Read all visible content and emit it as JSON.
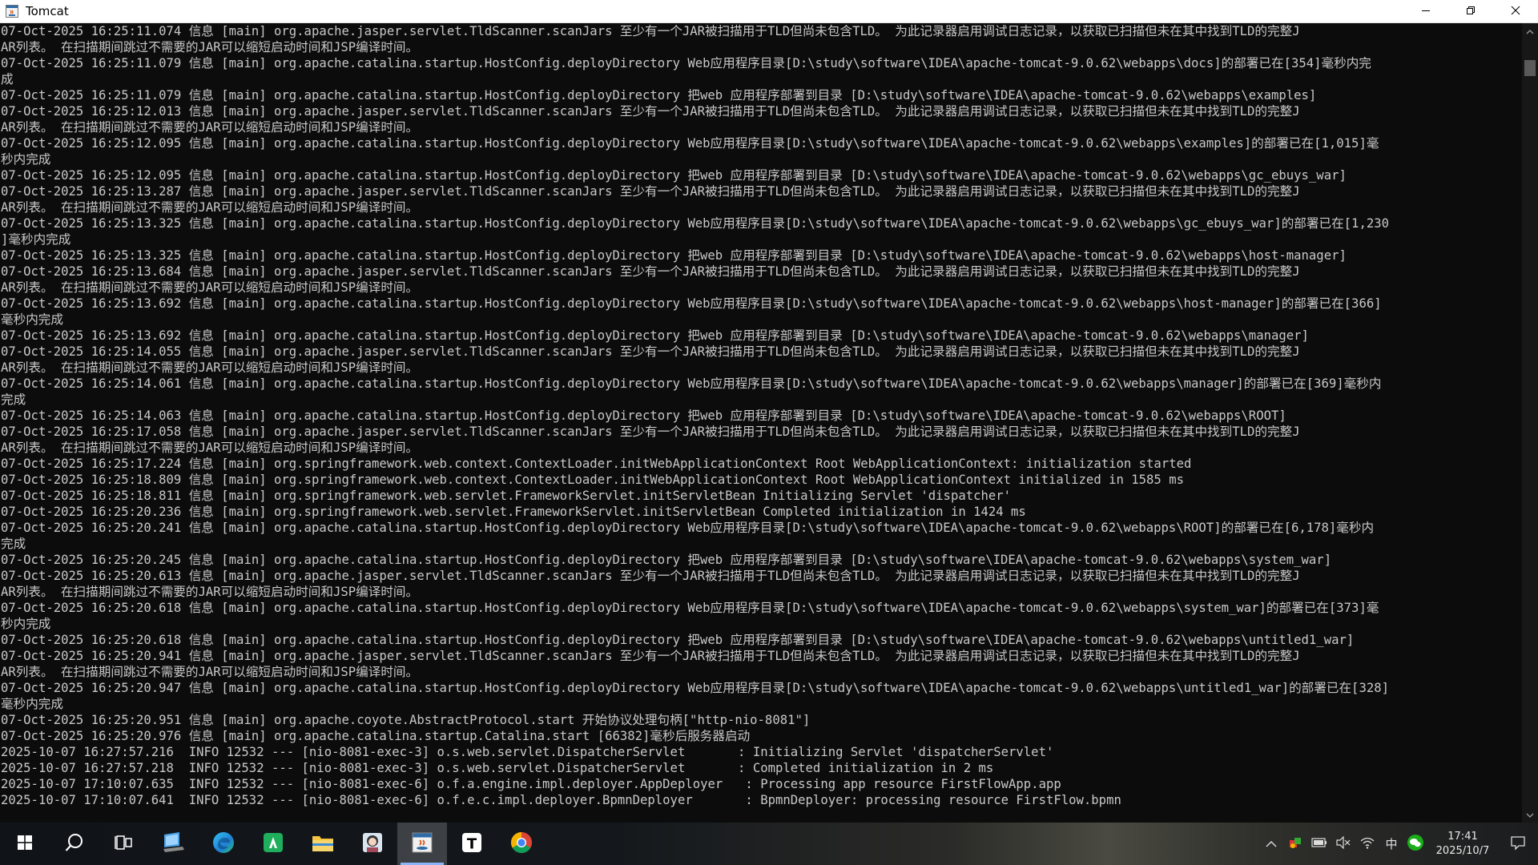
{
  "window": {
    "title": "Tomcat",
    "icon": "java-console-icon",
    "controls": [
      "minimize-icon",
      "restore-icon",
      "close-icon"
    ]
  },
  "console": {
    "lines": [
      "07-Oct-2025 16:25:11.074 信息 [main] org.apache.jasper.servlet.TldScanner.scanJars 至少有一个JAR被扫描用于TLD但尚未包含TLD。 为此记录器启用调试日志记录，以获取已扫描但未在其中找到TLD的完整J",
      "AR列表。 在扫描期间跳过不需要的JAR可以缩短启动时间和JSP编译时间。",
      "07-Oct-2025 16:25:11.079 信息 [main] org.apache.catalina.startup.HostConfig.deployDirectory Web应用程序目录[D:\\study\\software\\IDEA\\apache-tomcat-9.0.62\\webapps\\docs]的部署已在[354]毫秒内完",
      "成",
      "07-Oct-2025 16:25:11.079 信息 [main] org.apache.catalina.startup.HostConfig.deployDirectory 把web 应用程序部署到目录 [D:\\study\\software\\IDEA\\apache-tomcat-9.0.62\\webapps\\examples]",
      "07-Oct-2025 16:25:12.013 信息 [main] org.apache.jasper.servlet.TldScanner.scanJars 至少有一个JAR被扫描用于TLD但尚未包含TLD。 为此记录器启用调试日志记录，以获取已扫描但未在其中找到TLD的完整J",
      "AR列表。 在扫描期间跳过不需要的JAR可以缩短启动时间和JSP编译时间。",
      "07-Oct-2025 16:25:12.095 信息 [main] org.apache.catalina.startup.HostConfig.deployDirectory Web应用程序目录[D:\\study\\software\\IDEA\\apache-tomcat-9.0.62\\webapps\\examples]的部署已在[1,015]毫",
      "秒内完成",
      "07-Oct-2025 16:25:12.095 信息 [main] org.apache.catalina.startup.HostConfig.deployDirectory 把web 应用程序部署到目录 [D:\\study\\software\\IDEA\\apache-tomcat-9.0.62\\webapps\\gc_ebuys_war]",
      "07-Oct-2025 16:25:13.287 信息 [main] org.apache.jasper.servlet.TldScanner.scanJars 至少有一个JAR被扫描用于TLD但尚未包含TLD。 为此记录器启用调试日志记录，以获取已扫描但未在其中找到TLD的完整J",
      "AR列表。 在扫描期间跳过不需要的JAR可以缩短启动时间和JSP编译时间。",
      "07-Oct-2025 16:25:13.325 信息 [main] org.apache.catalina.startup.HostConfig.deployDirectory Web应用程序目录[D:\\study\\software\\IDEA\\apache-tomcat-9.0.62\\webapps\\gc_ebuys_war]的部署已在[1,230",
      "]毫秒内完成",
      "07-Oct-2025 16:25:13.325 信息 [main] org.apache.catalina.startup.HostConfig.deployDirectory 把web 应用程序部署到目录 [D:\\study\\software\\IDEA\\apache-tomcat-9.0.62\\webapps\\host-manager]",
      "07-Oct-2025 16:25:13.684 信息 [main] org.apache.jasper.servlet.TldScanner.scanJars 至少有一个JAR被扫描用于TLD但尚未包含TLD。 为此记录器启用调试日志记录，以获取已扫描但未在其中找到TLD的完整J",
      "AR列表。 在扫描期间跳过不需要的JAR可以缩短启动时间和JSP编译时间。",
      "07-Oct-2025 16:25:13.692 信息 [main] org.apache.catalina.startup.HostConfig.deployDirectory Web应用程序目录[D:\\study\\software\\IDEA\\apache-tomcat-9.0.62\\webapps\\host-manager]的部署已在[366]",
      "毫秒内完成",
      "07-Oct-2025 16:25:13.692 信息 [main] org.apache.catalina.startup.HostConfig.deployDirectory 把web 应用程序部署到目录 [D:\\study\\software\\IDEA\\apache-tomcat-9.0.62\\webapps\\manager]",
      "07-Oct-2025 16:25:14.055 信息 [main] org.apache.jasper.servlet.TldScanner.scanJars 至少有一个JAR被扫描用于TLD但尚未包含TLD。 为此记录器启用调试日志记录，以获取已扫描但未在其中找到TLD的完整J",
      "AR列表。 在扫描期间跳过不需要的JAR可以缩短启动时间和JSP编译时间。",
      "07-Oct-2025 16:25:14.061 信息 [main] org.apache.catalina.startup.HostConfig.deployDirectory Web应用程序目录[D:\\study\\software\\IDEA\\apache-tomcat-9.0.62\\webapps\\manager]的部署已在[369]毫秒内",
      "完成",
      "07-Oct-2025 16:25:14.063 信息 [main] org.apache.catalina.startup.HostConfig.deployDirectory 把web 应用程序部署到目录 [D:\\study\\software\\IDEA\\apache-tomcat-9.0.62\\webapps\\ROOT]",
      "07-Oct-2025 16:25:17.058 信息 [main] org.apache.jasper.servlet.TldScanner.scanJars 至少有一个JAR被扫描用于TLD但尚未包含TLD。 为此记录器启用调试日志记录，以获取已扫描但未在其中找到TLD的完整J",
      "AR列表。 在扫描期间跳过不需要的JAR可以缩短启动时间和JSP编译时间。",
      "07-Oct-2025 16:25:17.224 信息 [main] org.springframework.web.context.ContextLoader.initWebApplicationContext Root WebApplicationContext: initialization started",
      "07-Oct-2025 16:25:18.809 信息 [main] org.springframework.web.context.ContextLoader.initWebApplicationContext Root WebApplicationContext initialized in 1585 ms",
      "07-Oct-2025 16:25:18.811 信息 [main] org.springframework.web.servlet.FrameworkServlet.initServletBean Initializing Servlet 'dispatcher'",
      "07-Oct-2025 16:25:20.236 信息 [main] org.springframework.web.servlet.FrameworkServlet.initServletBean Completed initialization in 1424 ms",
      "07-Oct-2025 16:25:20.241 信息 [main] org.apache.catalina.startup.HostConfig.deployDirectory Web应用程序目录[D:\\study\\software\\IDEA\\apache-tomcat-9.0.62\\webapps\\ROOT]的部署已在[6,178]毫秒内",
      "完成",
      "07-Oct-2025 16:25:20.245 信息 [main] org.apache.catalina.startup.HostConfig.deployDirectory 把web 应用程序部署到目录 [D:\\study\\software\\IDEA\\apache-tomcat-9.0.62\\webapps\\system_war]",
      "07-Oct-2025 16:25:20.613 信息 [main] org.apache.jasper.servlet.TldScanner.scanJars 至少有一个JAR被扫描用于TLD但尚未包含TLD。 为此记录器启用调试日志记录，以获取已扫描但未在其中找到TLD的完整J",
      "AR列表。 在扫描期间跳过不需要的JAR可以缩短启动时间和JSP编译时间。",
      "07-Oct-2025 16:25:20.618 信息 [main] org.apache.catalina.startup.HostConfig.deployDirectory Web应用程序目录[D:\\study\\software\\IDEA\\apache-tomcat-9.0.62\\webapps\\system_war]的部署已在[373]毫",
      "秒内完成",
      "07-Oct-2025 16:25:20.618 信息 [main] org.apache.catalina.startup.HostConfig.deployDirectory 把web 应用程序部署到目录 [D:\\study\\software\\IDEA\\apache-tomcat-9.0.62\\webapps\\untitled1_war]",
      "07-Oct-2025 16:25:20.941 信息 [main] org.apache.jasper.servlet.TldScanner.scanJars 至少有一个JAR被扫描用于TLD但尚未包含TLD。 为此记录器启用调试日志记录，以获取已扫描但未在其中找到TLD的完整J",
      "AR列表。 在扫描期间跳过不需要的JAR可以缩短启动时间和JSP编译时间。",
      "07-Oct-2025 16:25:20.947 信息 [main] org.apache.catalina.startup.HostConfig.deployDirectory Web应用程序目录[D:\\study\\software\\IDEA\\apache-tomcat-9.0.62\\webapps\\untitled1_war]的部署已在[328]",
      "毫秒内完成",
      "07-Oct-2025 16:25:20.951 信息 [main] org.apache.coyote.AbstractProtocol.start 开始协议处理句柄[\"http-nio-8081\"]",
      "07-Oct-2025 16:25:20.976 信息 [main] org.apache.catalina.startup.Catalina.start [66382]毫秒后服务器启动",
      "2025-10-07 16:27:57.216  INFO 12532 --- [nio-8081-exec-3] o.s.web.servlet.DispatcherServlet       : Initializing Servlet 'dispatcherServlet'",
      "2025-10-07 16:27:57.218  INFO 12532 --- [nio-8081-exec-3] o.s.web.servlet.DispatcherServlet       : Completed initialization in 2 ms",
      "2025-10-07 17:10:07.635  INFO 12532 --- [nio-8081-exec-6] o.f.a.engine.impl.deployer.AppDeployer   : Processing app resource FirstFlowApp.app",
      "2025-10-07 17:10:07.641  INFO 12532 --- [nio-8081-exec-6] o.f.e.c.impl.deployer.BpmnDeployer       : BpmnDeployer: processing resource FirstFlow.bpmn"
    ]
  },
  "scrollbar": {
    "up_icon": "scroll-up-arrow-icon",
    "down_icon": "scroll-down-arrow-icon"
  },
  "taskbar": {
    "items": [
      {
        "name": "start-windows-icon",
        "active": false
      },
      {
        "name": "search-icon",
        "active": false
      },
      {
        "name": "task-view-icon",
        "active": false
      },
      {
        "name": "computer-icon",
        "active": false
      },
      {
        "name": "edge-browser-icon",
        "active": false
      },
      {
        "name": "green-app-icon",
        "active": false
      },
      {
        "name": "file-explorer-icon",
        "active": false
      },
      {
        "name": "avatar-app-icon",
        "active": false
      },
      {
        "name": "java-console-icon",
        "active": true
      },
      {
        "name": "typora-icon",
        "active": false
      },
      {
        "name": "chrome-icon",
        "active": false
      }
    ],
    "typora_letter": "T",
    "tray": {
      "icons": [
        "chevron-up-icon",
        "security-icon",
        "battery-icon",
        "volume-muted-icon",
        "network-icon"
      ],
      "ime_label": "中",
      "wechat_icon": "wechat-icon",
      "time": "17:41",
      "date": "2025/10/7",
      "notification_icon": "notification-icon"
    }
  },
  "colors": {
    "console_bg": "#0c0c0c",
    "console_text": "#c8c8c8",
    "titlebar_bg": "#ffffff",
    "taskbar_active": "#8ab4f8"
  }
}
